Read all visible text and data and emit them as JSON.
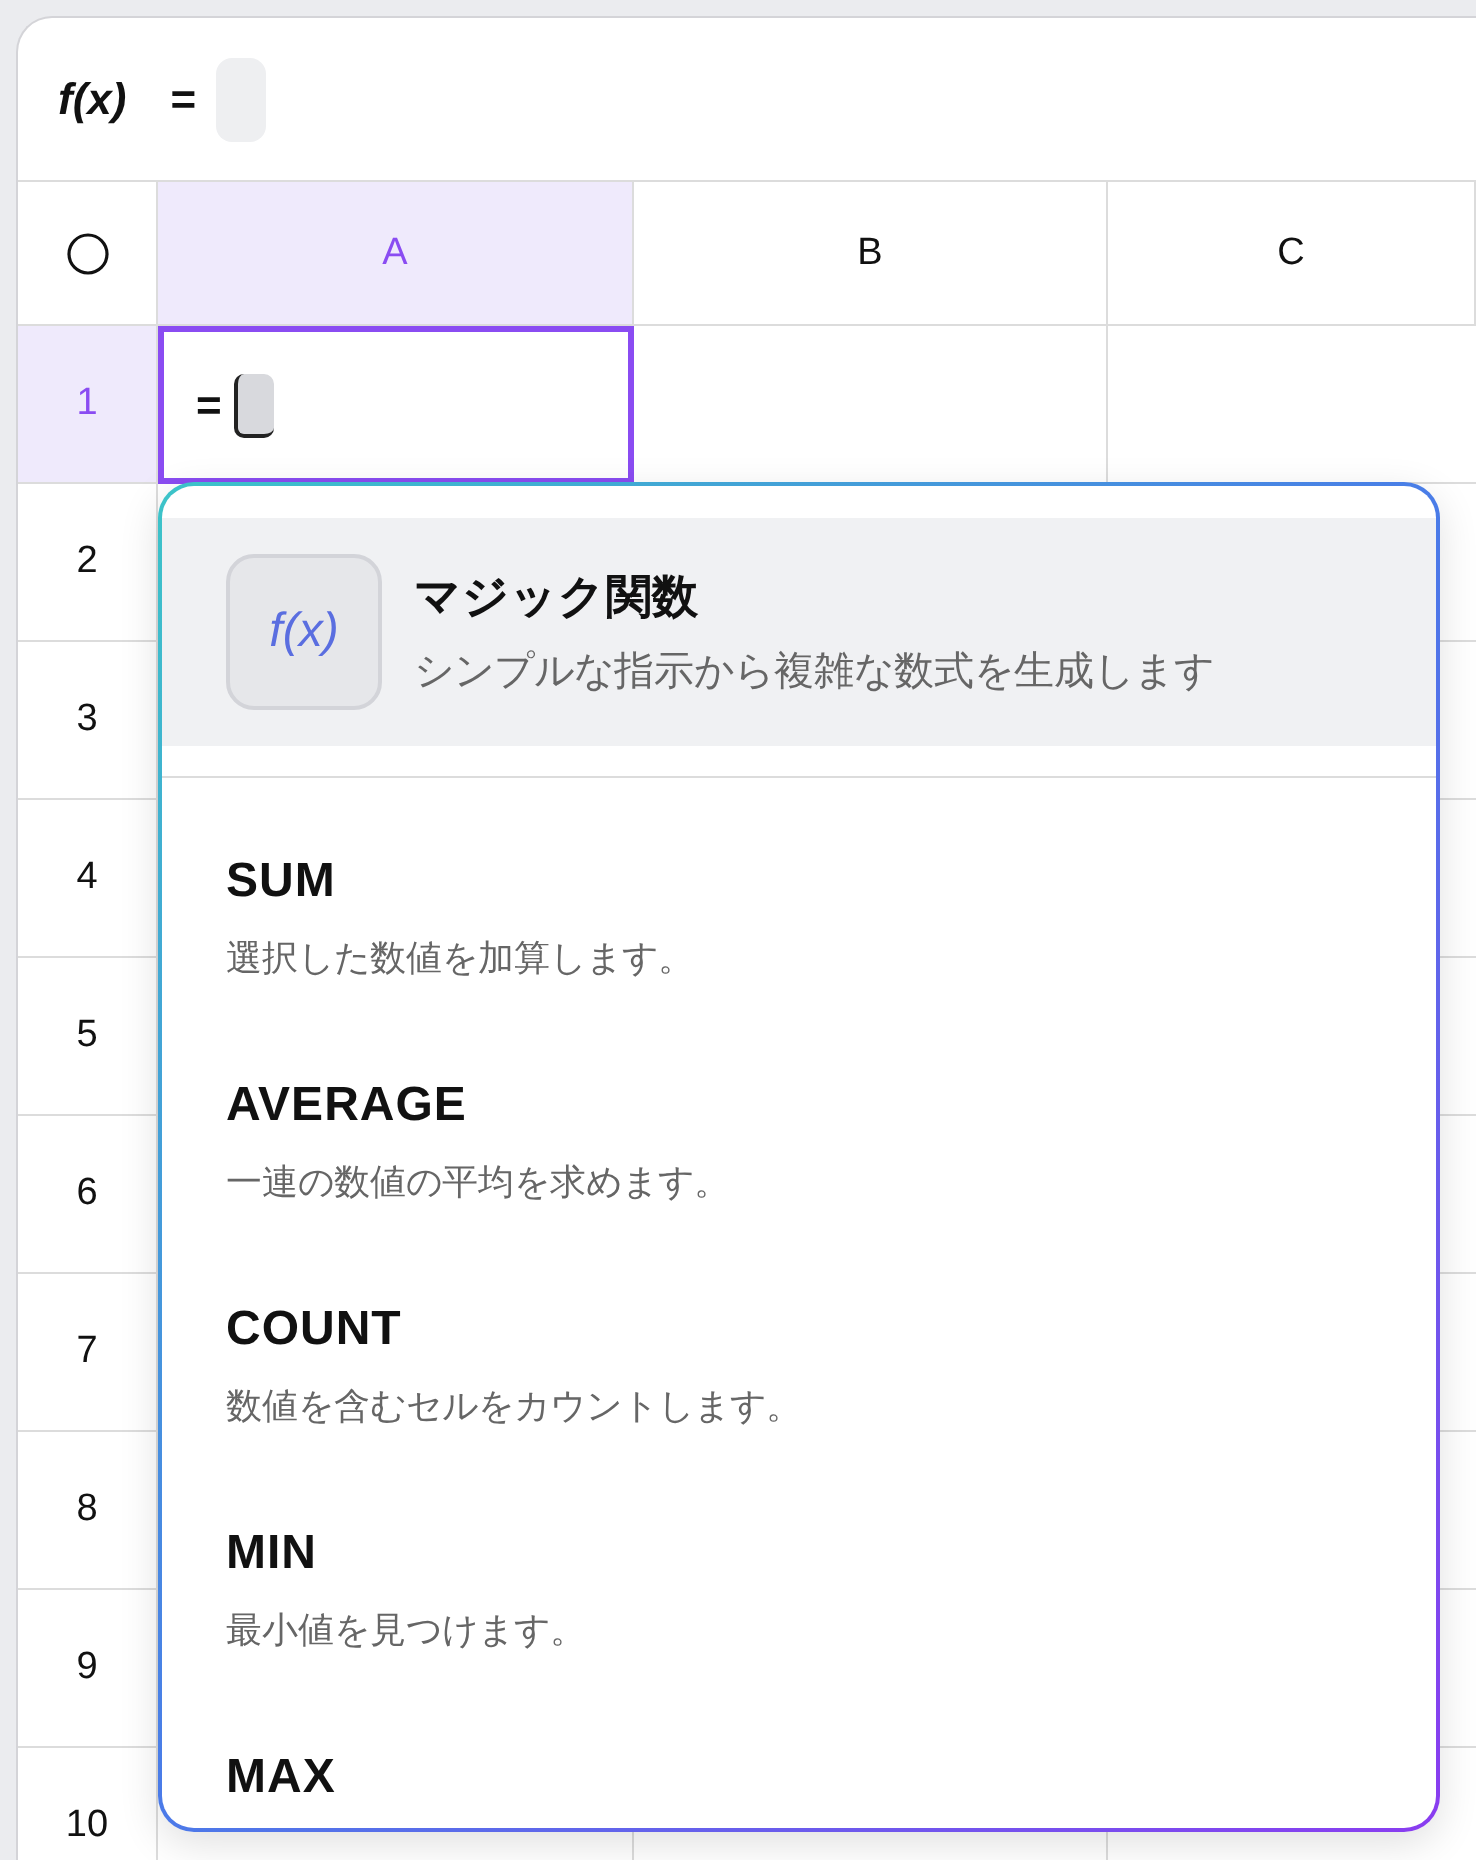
{
  "formula_bar": {
    "label": "f(x)",
    "value": "="
  },
  "columns": [
    {
      "label": "A",
      "selected": true
    },
    {
      "label": "B",
      "selected": false
    },
    {
      "label": "C",
      "selected": false
    }
  ],
  "rows": [
    {
      "label": "1",
      "selected": true,
      "cells": [
        "=",
        "",
        ""
      ]
    },
    {
      "label": "2",
      "selected": false,
      "cells": [
        "",
        "",
        ""
      ]
    },
    {
      "label": "3",
      "selected": false,
      "cells": [
        "",
        "",
        ""
      ]
    },
    {
      "label": "4",
      "selected": false,
      "cells": [
        "",
        "",
        ""
      ]
    },
    {
      "label": "5",
      "selected": false,
      "cells": [
        "",
        "",
        ""
      ]
    },
    {
      "label": "6",
      "selected": false,
      "cells": [
        "",
        "",
        ""
      ]
    },
    {
      "label": "7",
      "selected": false,
      "cells": [
        "",
        "",
        ""
      ]
    },
    {
      "label": "8",
      "selected": false,
      "cells": [
        "",
        "",
        ""
      ]
    },
    {
      "label": "9",
      "selected": false,
      "cells": [
        "",
        "",
        ""
      ]
    },
    {
      "label": "10",
      "selected": false,
      "cells": [
        "",
        "",
        ""
      ]
    }
  ],
  "suggestions": {
    "magic": {
      "icon_text": "f(x)",
      "title": "マジック関数",
      "description": "シンプルな指示から複雑な数式を生成します",
      "selected": true
    },
    "functions": [
      {
        "name": "SUM",
        "description": "選択した数値を加算します。"
      },
      {
        "name": "AVERAGE",
        "description": "一連の数値の平均を求めます。"
      },
      {
        "name": "COUNT",
        "description": "数値を含むセルをカウントします。"
      },
      {
        "name": "MIN",
        "description": "最小値を見つけます。"
      },
      {
        "name": "MAX"
      }
    ]
  }
}
